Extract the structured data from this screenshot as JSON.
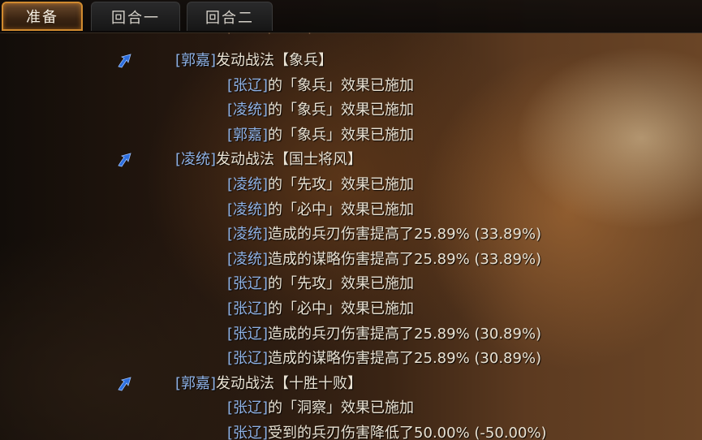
{
  "tabs": [
    {
      "label": "准备",
      "active": true
    },
    {
      "label": "回合一",
      "active": false
    },
    {
      "label": "回合二",
      "active": false
    }
  ],
  "colors": {
    "name": "#8fb2e6",
    "text": "#e9e2d3",
    "active_tab_border": "#d08a2f",
    "arrow": "#2d6fe0"
  },
  "log": [
    {
      "type": "skill",
      "name": "郭嘉",
      "text": "发动战法【象兵】",
      "icon": "blue-arrow-icon"
    },
    {
      "type": "effect",
      "name": "张辽",
      "text": "的「象兵」效果已施加"
    },
    {
      "type": "effect",
      "name": "凌统",
      "text": "的「象兵」效果已施加"
    },
    {
      "type": "effect",
      "name": "郭嘉",
      "text": "的「象兵」效果已施加"
    },
    {
      "type": "skill",
      "name": "凌统",
      "text": "发动战法【国士将风】",
      "icon": "blue-arrow-icon"
    },
    {
      "type": "effect",
      "name": "凌统",
      "text": "的「先攻」效果已施加"
    },
    {
      "type": "effect",
      "name": "凌统",
      "text": "的「必中」效果已施加"
    },
    {
      "type": "effect",
      "name": "凌统",
      "text": "造成的兵刃伤害提高了25.89% (33.89%)"
    },
    {
      "type": "effect",
      "name": "凌统",
      "text": "造成的谋略伤害提高了25.89% (33.89%)"
    },
    {
      "type": "effect",
      "name": "张辽",
      "text": "的「先攻」效果已施加"
    },
    {
      "type": "effect",
      "name": "张辽",
      "text": "的「必中」效果已施加"
    },
    {
      "type": "effect",
      "name": "张辽",
      "text": "造成的兵刃伤害提高了25.89% (30.89%)"
    },
    {
      "type": "effect",
      "name": "张辽",
      "text": "造成的谋略伤害提高了25.89% (30.89%)"
    },
    {
      "type": "skill",
      "name": "郭嘉",
      "text": "发动战法【十胜十败】",
      "icon": "blue-arrow-icon"
    },
    {
      "type": "effect",
      "name": "张辽",
      "text": "的「洞察」效果已施加"
    },
    {
      "type": "effect",
      "name": "张辽",
      "text": "受到的兵刃伤害降低了50.00% (-50.00%)"
    }
  ]
}
